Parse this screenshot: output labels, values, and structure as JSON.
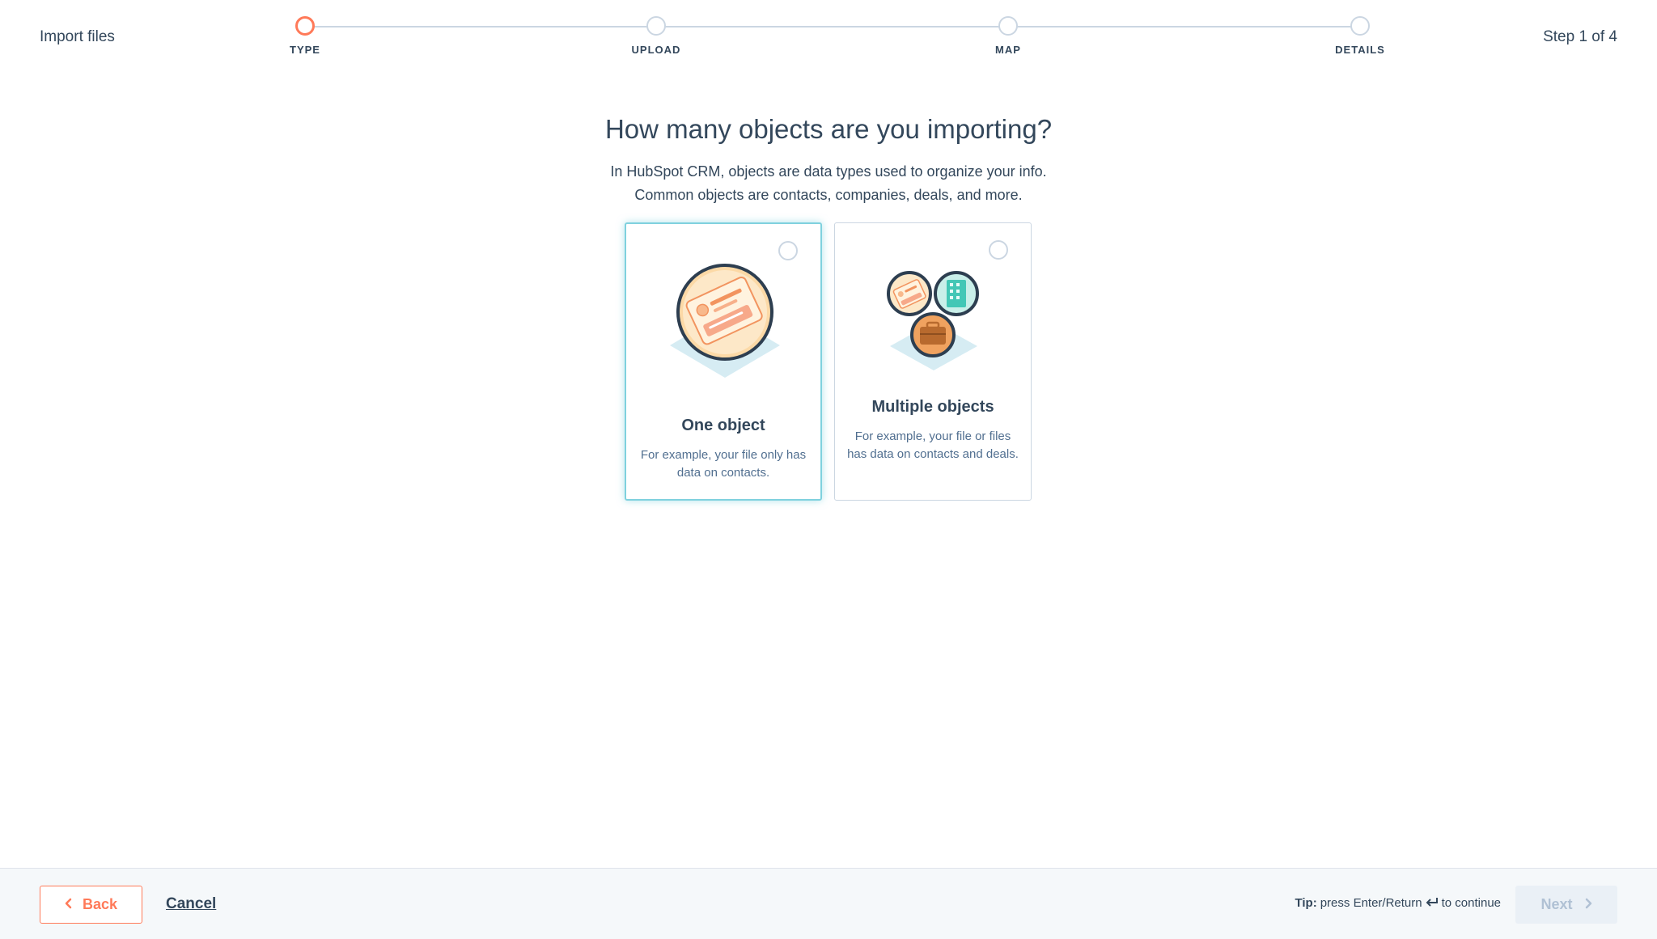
{
  "header": {
    "app_title": "Import files",
    "step_count": "Step 1 of 4",
    "steps": [
      {
        "label": "TYPE",
        "state": "active"
      },
      {
        "label": "UPLOAD",
        "state": "pending"
      },
      {
        "label": "MAP",
        "state": "pending"
      },
      {
        "label": "DETAILS",
        "state": "pending"
      }
    ]
  },
  "main": {
    "title": "How many objects are you importing?",
    "description_line1": "In HubSpot CRM, objects are data types used to organize your info.",
    "description_line2": "Common objects are contacts, companies, deals, and more.",
    "options": [
      {
        "title": "One object",
        "description": "For example, your file only has data on contacts.",
        "icon": "contact-card-icon",
        "selected": false,
        "highlighted": true
      },
      {
        "title": "Multiple objects",
        "description": "For example, your file or files has data on contacts and deals.",
        "icon": "multiple-objects-icon",
        "selected": false,
        "highlighted": false
      }
    ]
  },
  "footer": {
    "back_label": "Back",
    "cancel_label": "Cancel",
    "tip_prefix": "Tip:",
    "tip_text": "press Enter/Return",
    "tip_suffix": "to continue",
    "next_label": "Next",
    "next_disabled": true
  },
  "colors": {
    "accent": "#ff7a59",
    "text": "#33475b",
    "border": "#cbd6e2",
    "selected_border": "#7fd1de",
    "footer_bg": "#f5f8fa"
  }
}
